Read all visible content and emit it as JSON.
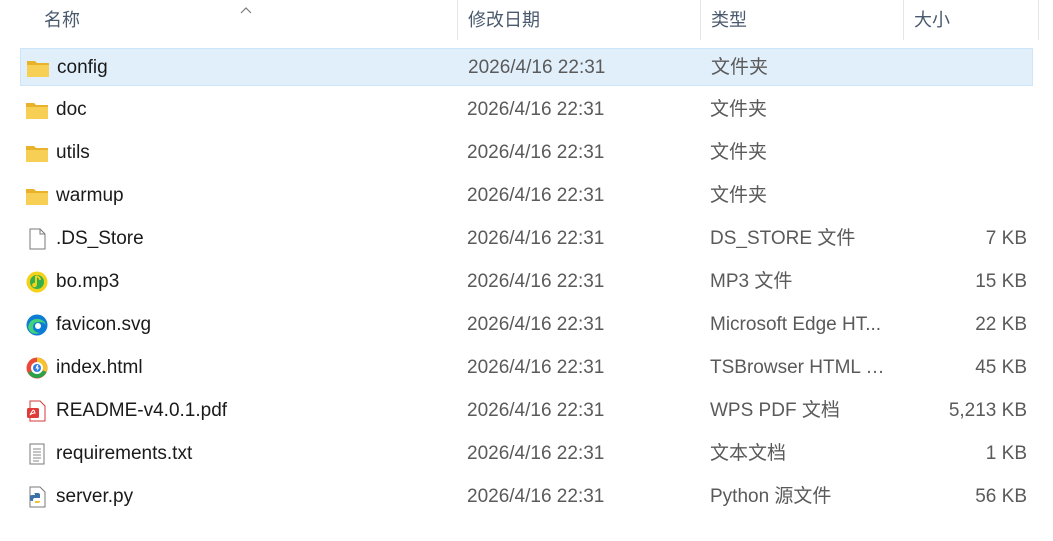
{
  "columns": {
    "name": "名称",
    "date": "修改日期",
    "type": "类型",
    "size": "大小"
  },
  "files": [
    {
      "name": "config",
      "date": "2026/4/16 22:31",
      "type": "文件夹",
      "size": "",
      "icon": "folder-icon",
      "selected": true
    },
    {
      "name": "doc",
      "date": "2026/4/16 22:31",
      "type": "文件夹",
      "size": "",
      "icon": "folder-icon"
    },
    {
      "name": "utils",
      "date": "2026/4/16 22:31",
      "type": "文件夹",
      "size": "",
      "icon": "folder-icon"
    },
    {
      "name": "warmup",
      "date": "2026/4/16 22:31",
      "type": "文件夹",
      "size": "",
      "icon": "folder-icon"
    },
    {
      "name": ".DS_Store",
      "date": "2026/4/16 22:31",
      "type": "DS_STORE 文件",
      "size": "7 KB",
      "icon": "blank-file-icon"
    },
    {
      "name": "bo.mp3",
      "date": "2026/4/16 22:31",
      "type": "MP3 文件",
      "size": "15 KB",
      "icon": "music-note-icon"
    },
    {
      "name": "favicon.svg",
      "date": "2026/4/16 22:31",
      "type": "Microsoft Edge HT...",
      "size": "22 KB",
      "icon": "edge-browser-icon"
    },
    {
      "name": "index.html",
      "date": "2026/4/16 22:31",
      "type": "TSBrowser HTML D...",
      "size": "45 KB",
      "icon": "tsbrowser-icon"
    },
    {
      "name": "README-v4.0.1.pdf",
      "date": "2026/4/16 22:31",
      "type": "WPS PDF 文档",
      "size": "5,213 KB",
      "icon": "pdf-icon"
    },
    {
      "name": "requirements.txt",
      "date": "2026/4/16 22:31",
      "type": "文本文档",
      "size": "1 KB",
      "icon": "text-file-icon"
    },
    {
      "name": "server.py",
      "date": "2026/4/16 22:31",
      "type": "Python 源文件",
      "size": "56 KB",
      "icon": "python-file-icon"
    }
  ],
  "colors": {
    "selected_bg": "#e1effb",
    "folder": "#f5c342"
  }
}
